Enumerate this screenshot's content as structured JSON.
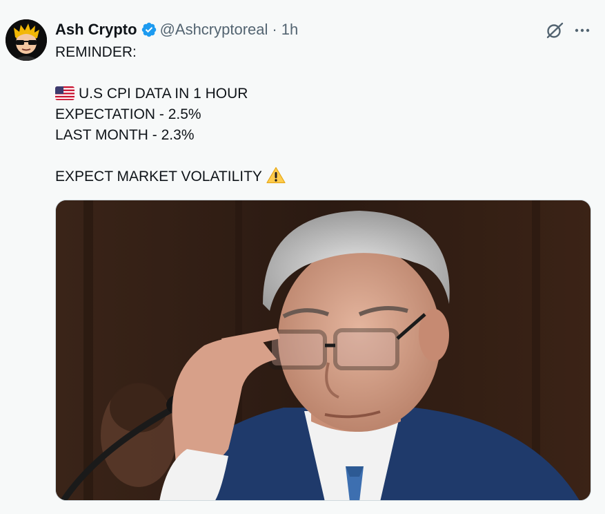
{
  "tweet": {
    "author": {
      "display_name": "Ash Crypto",
      "handle": "@Ashcryptoreal",
      "verified_icon": "verified-badge-icon",
      "avatar_icon": "cartoon-avatar-icon"
    },
    "separator": "·",
    "time": "1h",
    "actions": {
      "grok_icon": "grok-icon",
      "more_icon": "more-icon"
    },
    "lines": {
      "l1": "REMINDER:",
      "l2": "U.S CPI DATA IN 1 HOUR",
      "l3": "EXPECTATION - 2.5%",
      "l4": "LAST MONTH - 2.3%",
      "l5": "EXPECT MARKET VOLATILITY"
    },
    "emoji": {
      "flag": "us-flag-icon",
      "warning": "warning-icon"
    },
    "media": {
      "type": "photo"
    }
  },
  "colors": {
    "background": "#f7f9f9",
    "text": "#0f1419",
    "secondary": "#536471",
    "verified": "#1d9bf0"
  }
}
